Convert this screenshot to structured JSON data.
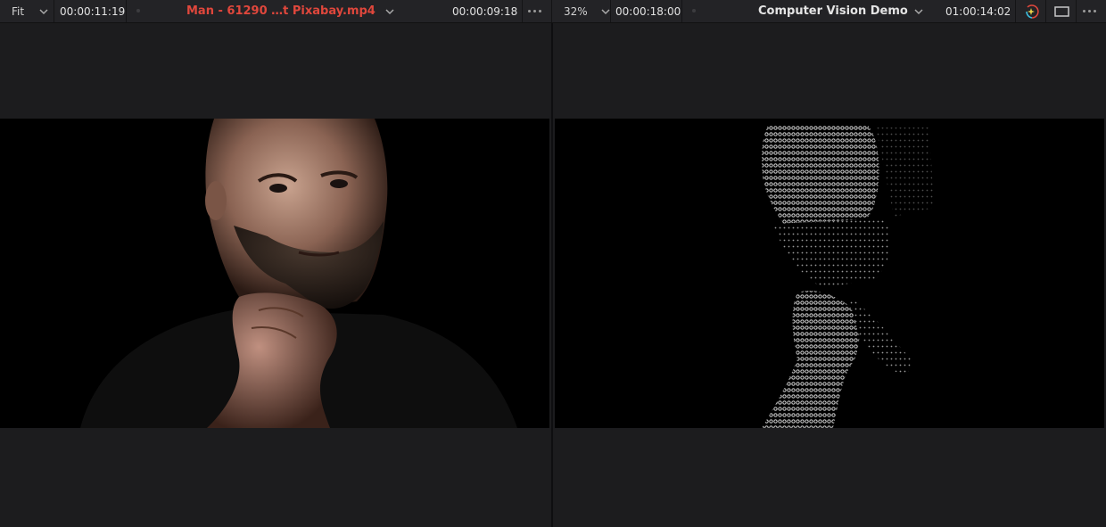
{
  "source_viewer": {
    "zoom": "Fit",
    "timecode_left": "00:00:11:19",
    "clip_title": "Man - 61290  …t Pixabay.mp4",
    "timecode_right": "00:00:09:18",
    "title_color": "#e0473c"
  },
  "timeline_viewer": {
    "zoom": "32%",
    "timecode_left": "00:00:18:00",
    "timeline_title": "Computer Vision Demo",
    "timecode_right": "01:00:14:02"
  },
  "icons": {
    "source_zoom_chevron": "chevron-down-icon",
    "source_title_chevron": "chevron-down-icon",
    "source_options": "more-options-icon",
    "timeline_zoom_chevron": "chevron-down-icon",
    "timeline_title_chevron": "chevron-down-icon",
    "effects_overlay": "sparkle-color-icon",
    "viewer_mode": "rectangle-frame-icon",
    "timeline_options": "more-options-icon"
  },
  "colors": {
    "background": "#1c1c1e",
    "toolbar": "#232326",
    "accent_red": "#e0473c"
  }
}
